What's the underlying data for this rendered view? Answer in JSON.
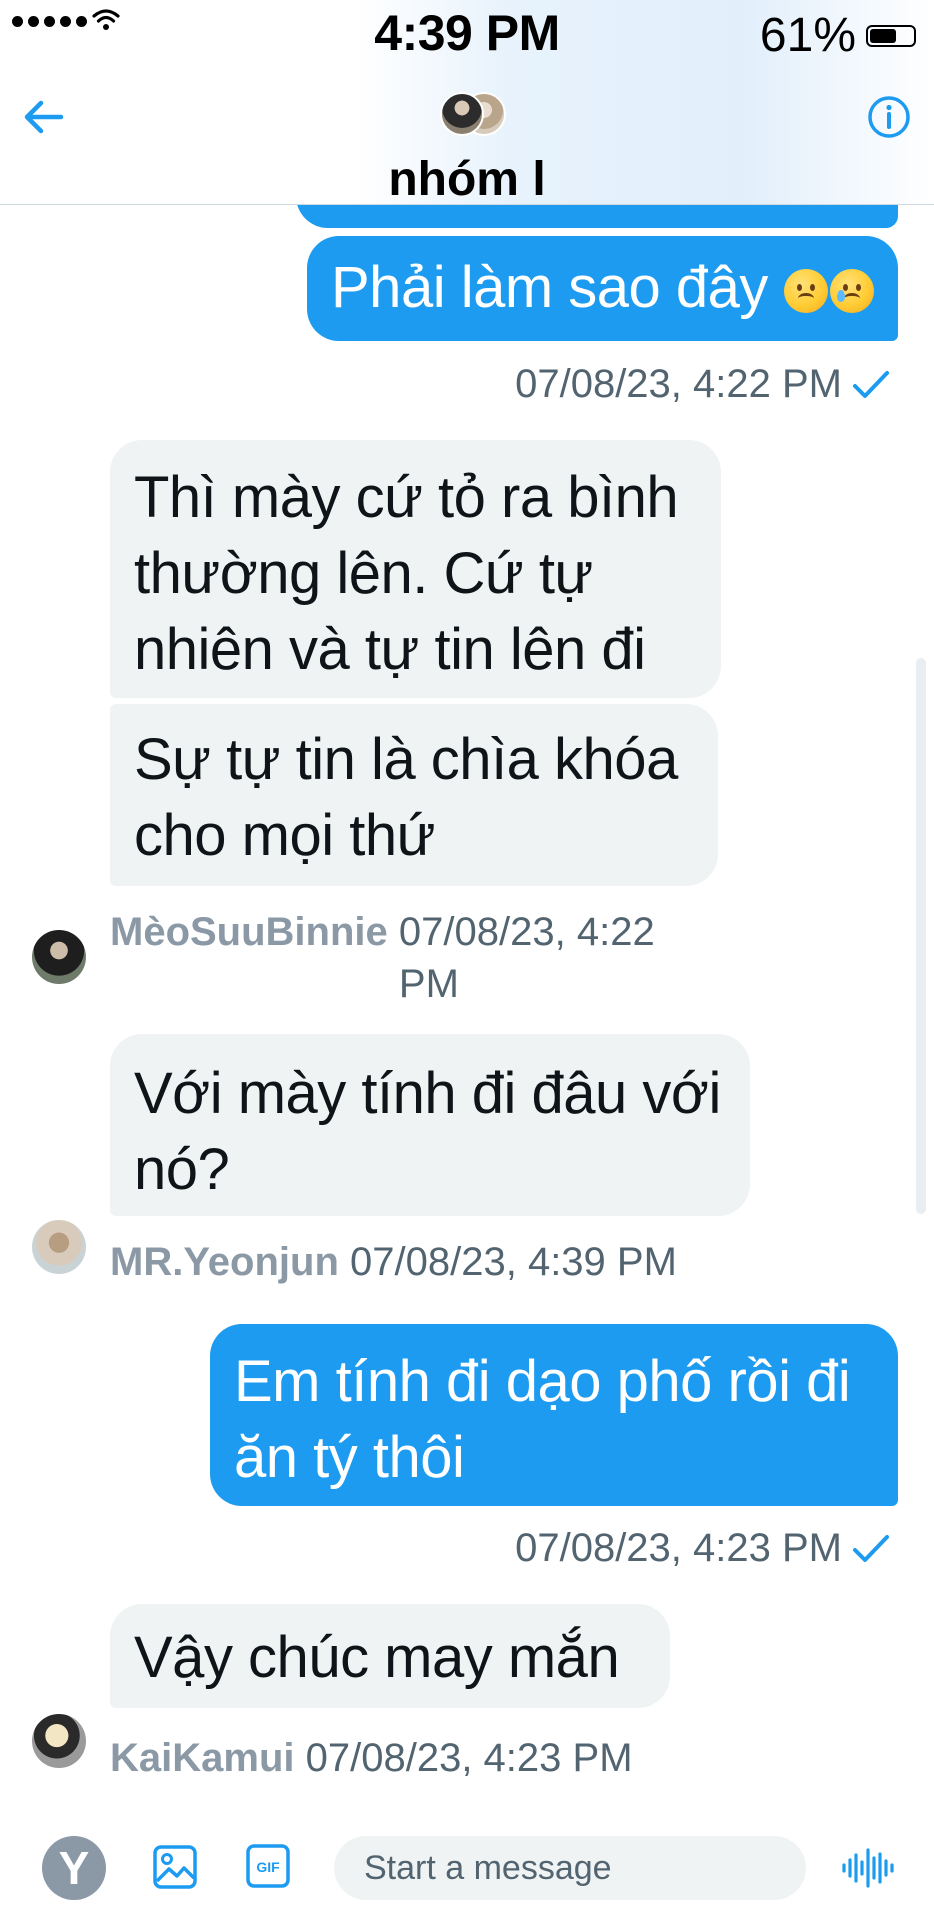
{
  "status_bar": {
    "time": "4:39 PM",
    "battery_text": "61%",
    "battery_level": 0.61
  },
  "header": {
    "title": "nhóm l",
    "back_icon": "arrow-left-icon",
    "info_icon": "info-icon"
  },
  "messages": [
    {
      "id": "m1",
      "direction": "sent",
      "text": "Phải làm sao đây",
      "emoji": [
        "sad-relieved-face",
        "crying-face"
      ],
      "timestamp": "07/08/23, 4:22 PM",
      "status_icon": "check-icon"
    },
    {
      "id": "m2",
      "direction": "received",
      "text": "Thì mày cứ tỏ ra bình thường lên. Cứ tự nhiên và tự tin lên đi"
    },
    {
      "id": "m3",
      "direction": "received",
      "text": "Sự tự tin là chìa khóa cho mọi thứ",
      "sender": "MèoSuuBinnie",
      "timestamp": "07/08/23, 4:22 PM"
    },
    {
      "id": "m4",
      "direction": "received",
      "text": "Với mày tính đi đâu với nó?",
      "sender": "MR.Yeonjun",
      "timestamp": "07/08/23, 4:39 PM"
    },
    {
      "id": "m5",
      "direction": "sent",
      "text": "Em tính đi dạo phố rồi đi ăn tý thôi",
      "timestamp": "07/08/23, 4:23 PM",
      "status_icon": "check-icon"
    },
    {
      "id": "m6",
      "direction": "received",
      "text": "Vậy chúc may mắn",
      "sender": "KaiKamui",
      "timestamp": "07/08/23, 4:23 PM"
    }
  ],
  "composer": {
    "logo_letter": "Y",
    "placeholder": "Start a message",
    "gif_label": "GIF"
  },
  "colors": {
    "accent": "#1d9bf0",
    "received_bubble": "#eff3f4",
    "meta_text": "#536471",
    "sender_text": "#8b98a5"
  }
}
